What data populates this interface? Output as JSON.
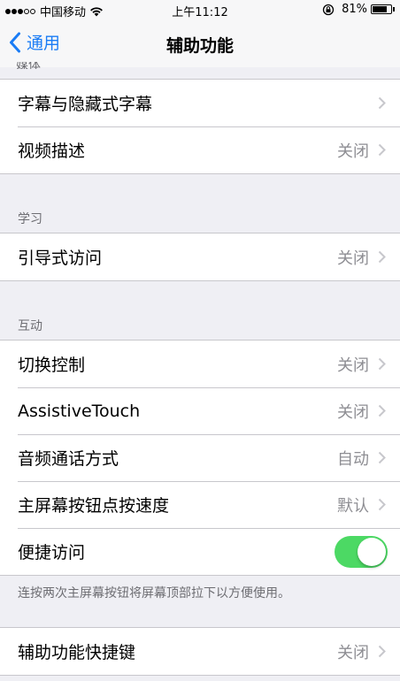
{
  "status_bar": {
    "carrier": "中国移动",
    "time": "上午11:12",
    "battery_percent": "81%",
    "battery_level": 0.81,
    "signal_dots": [
      true,
      true,
      true,
      false,
      false
    ]
  },
  "nav": {
    "back_label": "通用",
    "title": "辅助功能"
  },
  "partial_section_header": "媒体",
  "media_section": {
    "rows": [
      {
        "label": "字幕与隐藏式字幕",
        "value": ""
      },
      {
        "label": "视频描述",
        "value": "关闭"
      }
    ]
  },
  "learning_section": {
    "header": "学习",
    "rows": [
      {
        "label": "引导式访问",
        "value": "关闭"
      }
    ]
  },
  "interaction_section": {
    "header": "互动",
    "rows": [
      {
        "label": "切换控制",
        "value": "关闭"
      },
      {
        "label": "AssistiveTouch",
        "value": "关闭"
      },
      {
        "label": "音频通话方式",
        "value": "自动"
      },
      {
        "label": "主屏幕按钮点按速度",
        "value": "默认"
      }
    ],
    "toggle_row": {
      "label": "便捷访问",
      "on": true
    },
    "footer": "连按两次主屏幕按钮将屏幕顶部拉下以方便使用。"
  },
  "shortcut_section": {
    "rows": [
      {
        "label": "辅助功能快捷键",
        "value": "关闭"
      }
    ]
  },
  "colors": {
    "accent": "#1a7cf5",
    "toggle_on": "#4cd964",
    "background": "#efeff4"
  }
}
